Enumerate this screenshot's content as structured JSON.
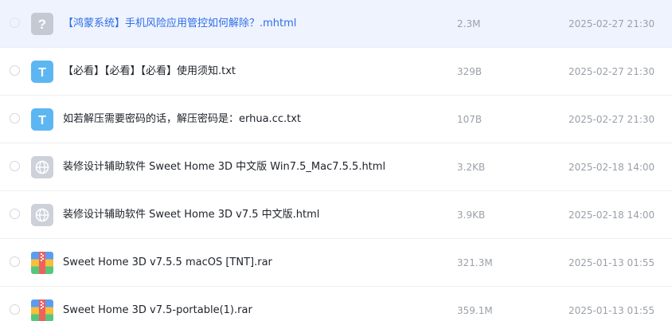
{
  "files": [
    {
      "name": "【鸿蒙系统】手机风险应用管控如何解除？.mhtml",
      "size": "2.3M",
      "modified": "2025-02-27 21:30",
      "icon": "unknown-file-icon",
      "hovered": true
    },
    {
      "name": "【必看】【必看】【必看】使用须知.txt",
      "size": "329B",
      "modified": "2025-02-27 21:30",
      "icon": "text-file-icon"
    },
    {
      "name": "如若解压需要密码的话，解压密码是：erhua.cc.txt",
      "size": "107B",
      "modified": "2025-02-27 21:30",
      "icon": "text-file-icon"
    },
    {
      "name": "装修设计辅助软件 Sweet Home 3D 中文版 Win7.5_Mac7.5.5.html",
      "size": "3.2KB",
      "modified": "2025-02-18 14:00",
      "icon": "web-file-icon"
    },
    {
      "name": "装修设计辅助软件 Sweet Home 3D v7.5 中文版.html",
      "size": "3.9KB",
      "modified": "2025-02-18 14:00",
      "icon": "web-file-icon"
    },
    {
      "name": "Sweet Home 3D v7.5.5 macOS [TNT].rar",
      "size": "321.3M",
      "modified": "2025-01-13 01:55",
      "icon": "archive-file-icon"
    },
    {
      "name": "Sweet Home 3D v7.5-portable(1).rar",
      "size": "359.1M",
      "modified": "2025-01-13 01:55",
      "icon": "archive-file-icon"
    }
  ],
  "colors": {
    "hover_bg": "#eef3fe",
    "link_blue": "#2f6ee6",
    "text_icon_blue": "#5cb6f2",
    "meta_gray": "#9ba0a9"
  }
}
